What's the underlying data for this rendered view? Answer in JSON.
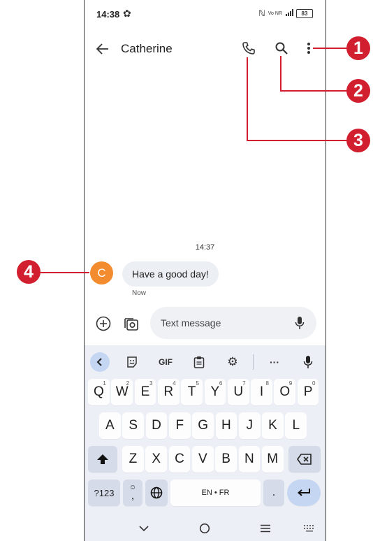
{
  "status_bar": {
    "time": "14:38",
    "battery": "83",
    "network": "Vo NR"
  },
  "app_bar": {
    "title": "Catherine"
  },
  "conversation": {
    "timestamp": "14:37",
    "messages": [
      {
        "avatar_letter": "C",
        "text": "Have a good day!",
        "meta": "Now"
      }
    ]
  },
  "compose": {
    "placeholder": "Text message"
  },
  "keyboard": {
    "toolbar": [
      "<",
      "sticker",
      "GIF",
      "clipboard",
      "settings",
      "...",
      "mic"
    ],
    "row1": [
      {
        "k": "Q",
        "h": "1"
      },
      {
        "k": "W",
        "h": "2"
      },
      {
        "k": "E",
        "h": "3"
      },
      {
        "k": "R",
        "h": "4"
      },
      {
        "k": "T",
        "h": "5"
      },
      {
        "k": "Y",
        "h": "6"
      },
      {
        "k": "U",
        "h": "7"
      },
      {
        "k": "I",
        "h": "8"
      },
      {
        "k": "O",
        "h": "9"
      },
      {
        "k": "P",
        "h": "0"
      }
    ],
    "row2": [
      "A",
      "S",
      "D",
      "F",
      "G",
      "H",
      "J",
      "K",
      "L"
    ],
    "row3": [
      "Z",
      "X",
      "C",
      "V",
      "B",
      "N",
      "M"
    ],
    "gif": "GIF",
    "symbols_key": "?123",
    "emoji_comma": ",",
    "space": "EN • FR",
    "period": "."
  },
  "callouts": [
    "1",
    "2",
    "3",
    "4"
  ],
  "colors": {
    "callout": "#d21f2f",
    "avatar": "#f28c2e",
    "keyboard_bg": "#eceff6",
    "enter_key": "#c5d6f3"
  }
}
